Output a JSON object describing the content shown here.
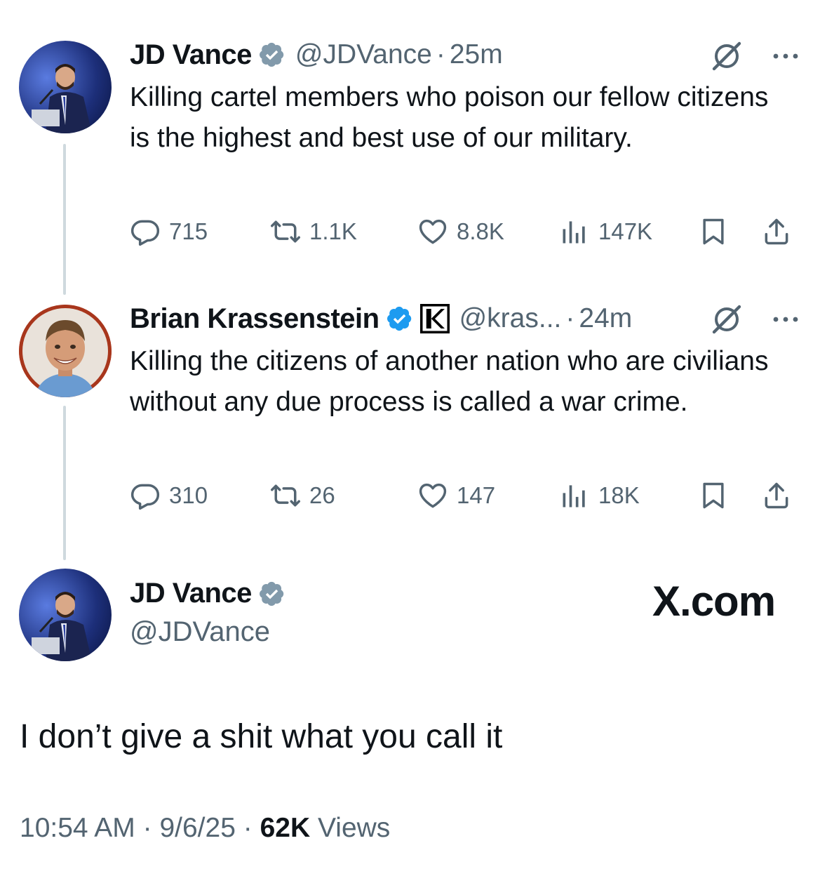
{
  "tweet1": {
    "name": "JD Vance",
    "handle": "@JDVance",
    "time": "25m",
    "text": "Killing cartel members who poison our fellow citizens is the highest and best use of our military.",
    "replies": "715",
    "reposts": "1.1K",
    "likes": "8.8K",
    "views": "147K"
  },
  "tweet2": {
    "name": "Brian Krassenstein",
    "handle": "@kras...",
    "time": "24m",
    "text": "Killing the citizens of another nation who are civilians without any due process is called a war crime.",
    "replies": "310",
    "reposts": "26",
    "likes": "147",
    "views": "18K"
  },
  "reply": {
    "name": "JD Vance",
    "handle": "@JDVance",
    "brand": "X.com",
    "text": "I don’t give a shit what you call it",
    "time": "10:54 AM",
    "date": "9/6/25",
    "views_count": "62K",
    "views_label": "Views"
  },
  "separator": "·",
  "icons": {
    "reply": "reply-icon",
    "repost": "repost-icon",
    "like": "heart-icon",
    "views": "views-icon",
    "bookmark": "bookmark-icon",
    "share": "share-icon",
    "grok": "grok-icon",
    "more": "more-icon",
    "verified": "verified-badge-icon"
  },
  "colors": {
    "verified_blue": "#1d9bf0",
    "verified_gray": "#829aab",
    "secondary_text": "#536471",
    "primary_text": "#0f1419"
  }
}
